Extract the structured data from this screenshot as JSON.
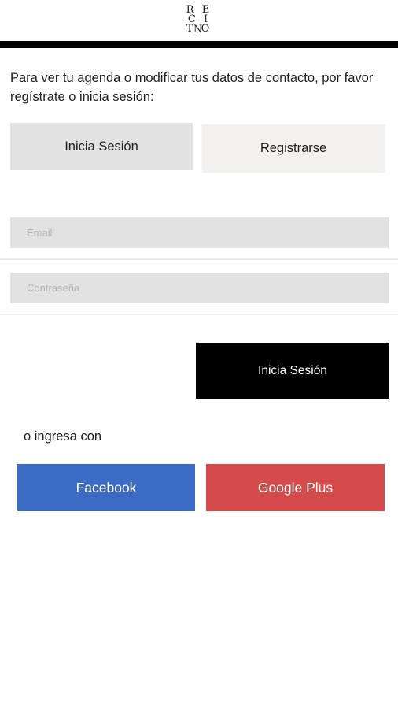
{
  "header": {
    "logo": {
      "row1": "R E",
      "row2": "C I N",
      "row3": "T O"
    }
  },
  "intro": {
    "text": "Para ver tu agenda o modificar tus datos de contacto, por favor regístrate o inicia sesión:"
  },
  "tabs": {
    "login_label": "Inicia Sesión",
    "register_label": "Registrarse",
    "active": "login"
  },
  "form": {
    "email": {
      "placeholder": "Email",
      "value": ""
    },
    "password": {
      "placeholder": "Contraseña",
      "value": ""
    },
    "submit_label": "Inicia Sesión"
  },
  "social": {
    "or_text": "o ingresa con",
    "facebook_label": "Facebook",
    "google_label": "Google Plus"
  },
  "colors": {
    "facebook": "#3b6bc5",
    "google": "#d54b4b",
    "submit": "#000000",
    "tab_active": "#e2e2e2",
    "tab_inactive": "#f3f1ee"
  }
}
